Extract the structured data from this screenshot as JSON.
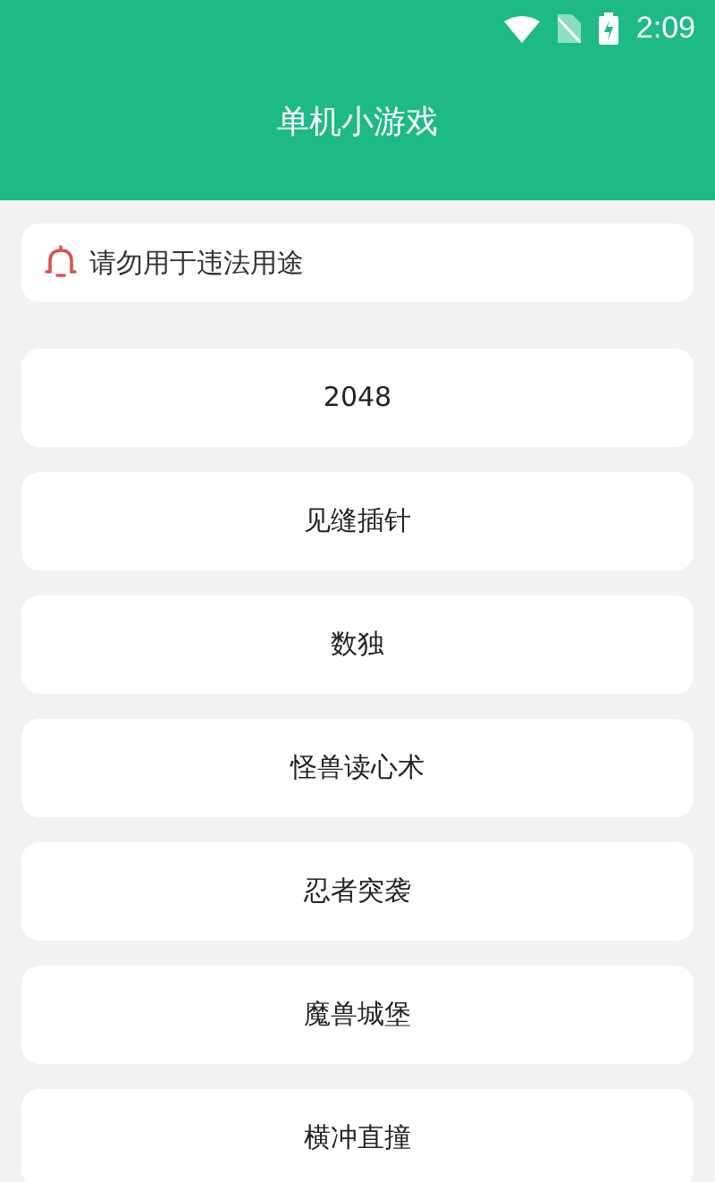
{
  "status_bar": {
    "time": "2:09"
  },
  "app_bar": {
    "title": "单机小游戏"
  },
  "notice": {
    "text": "请勿用于违法用途"
  },
  "games": [
    {
      "label": "2048"
    },
    {
      "label": "见缝插针"
    },
    {
      "label": "数独"
    },
    {
      "label": "怪兽读心术"
    },
    {
      "label": "忍者突袭"
    },
    {
      "label": "魔兽城堡"
    },
    {
      "label": "横冲直撞"
    }
  ]
}
